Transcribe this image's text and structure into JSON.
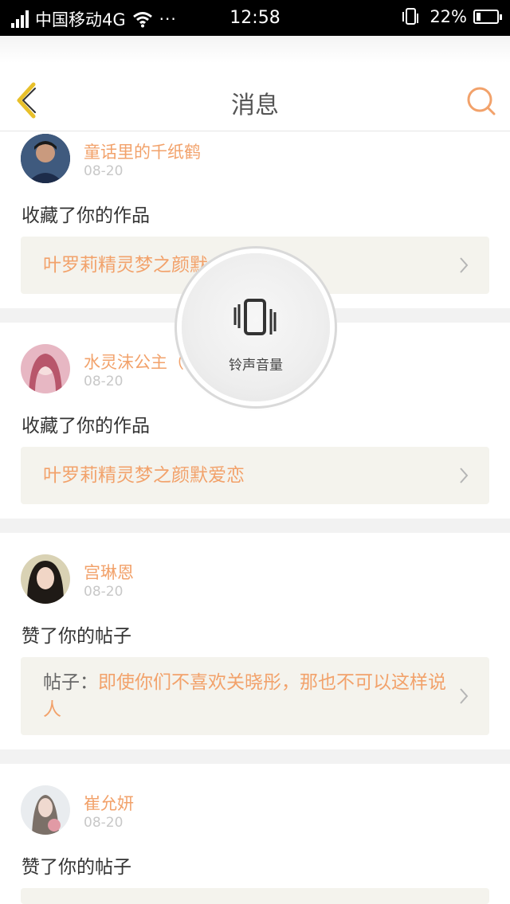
{
  "status_bar": {
    "carrier": "中国移动4G",
    "dots": "···",
    "time": "12:58",
    "battery_percent": "22%",
    "battery_level": 0.22
  },
  "header": {
    "title": "消息"
  },
  "messages": [
    {
      "user": "童话里的千纸鹤",
      "date": "08-20",
      "action": "收藏了你的作品",
      "link_prefix": "",
      "link_text": "叶罗莉精灵梦之颜默"
    },
    {
      "user": "水灵沫公主（",
      "date": "08-20",
      "action": "收藏了你的作品",
      "link_prefix": "",
      "link_text": "叶罗莉精灵梦之颜默爱恋"
    },
    {
      "user": "宫琳恩",
      "date": "08-20",
      "action": "赞了你的帖子",
      "link_prefix": "帖子：",
      "link_text": "即使你们不喜欢关晓彤，那也不可以这样说人"
    },
    {
      "user": "崔允妍",
      "date": "08-20",
      "action": "赞了你的帖子",
      "link_prefix": "",
      "link_text": ""
    }
  ],
  "overlay": {
    "label": "铃声音量"
  },
  "colors": {
    "accent": "#f2a26b",
    "back_icon": "#e8c02a",
    "link_bg": "#f4f3ed"
  }
}
